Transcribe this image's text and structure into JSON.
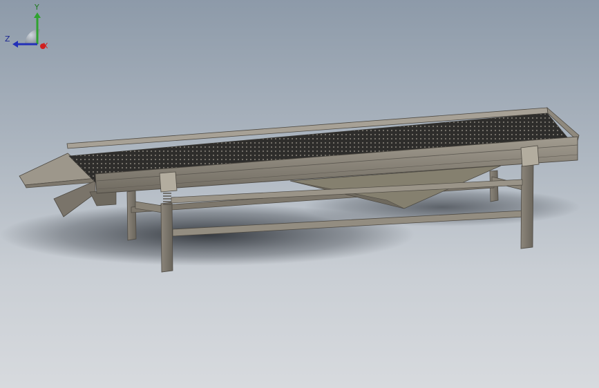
{
  "viewport": {
    "background_top": "#8d9aa9",
    "background_bottom": "#d7dade",
    "model_color": "#8a8478",
    "mesh_color": "#2b2a28"
  },
  "triad": {
    "x_label": "X",
    "y_label": "Y",
    "z_label": "Z",
    "x_color": "#d11f1f",
    "y_color": "#2fa32f",
    "z_color": "#2330b8"
  }
}
